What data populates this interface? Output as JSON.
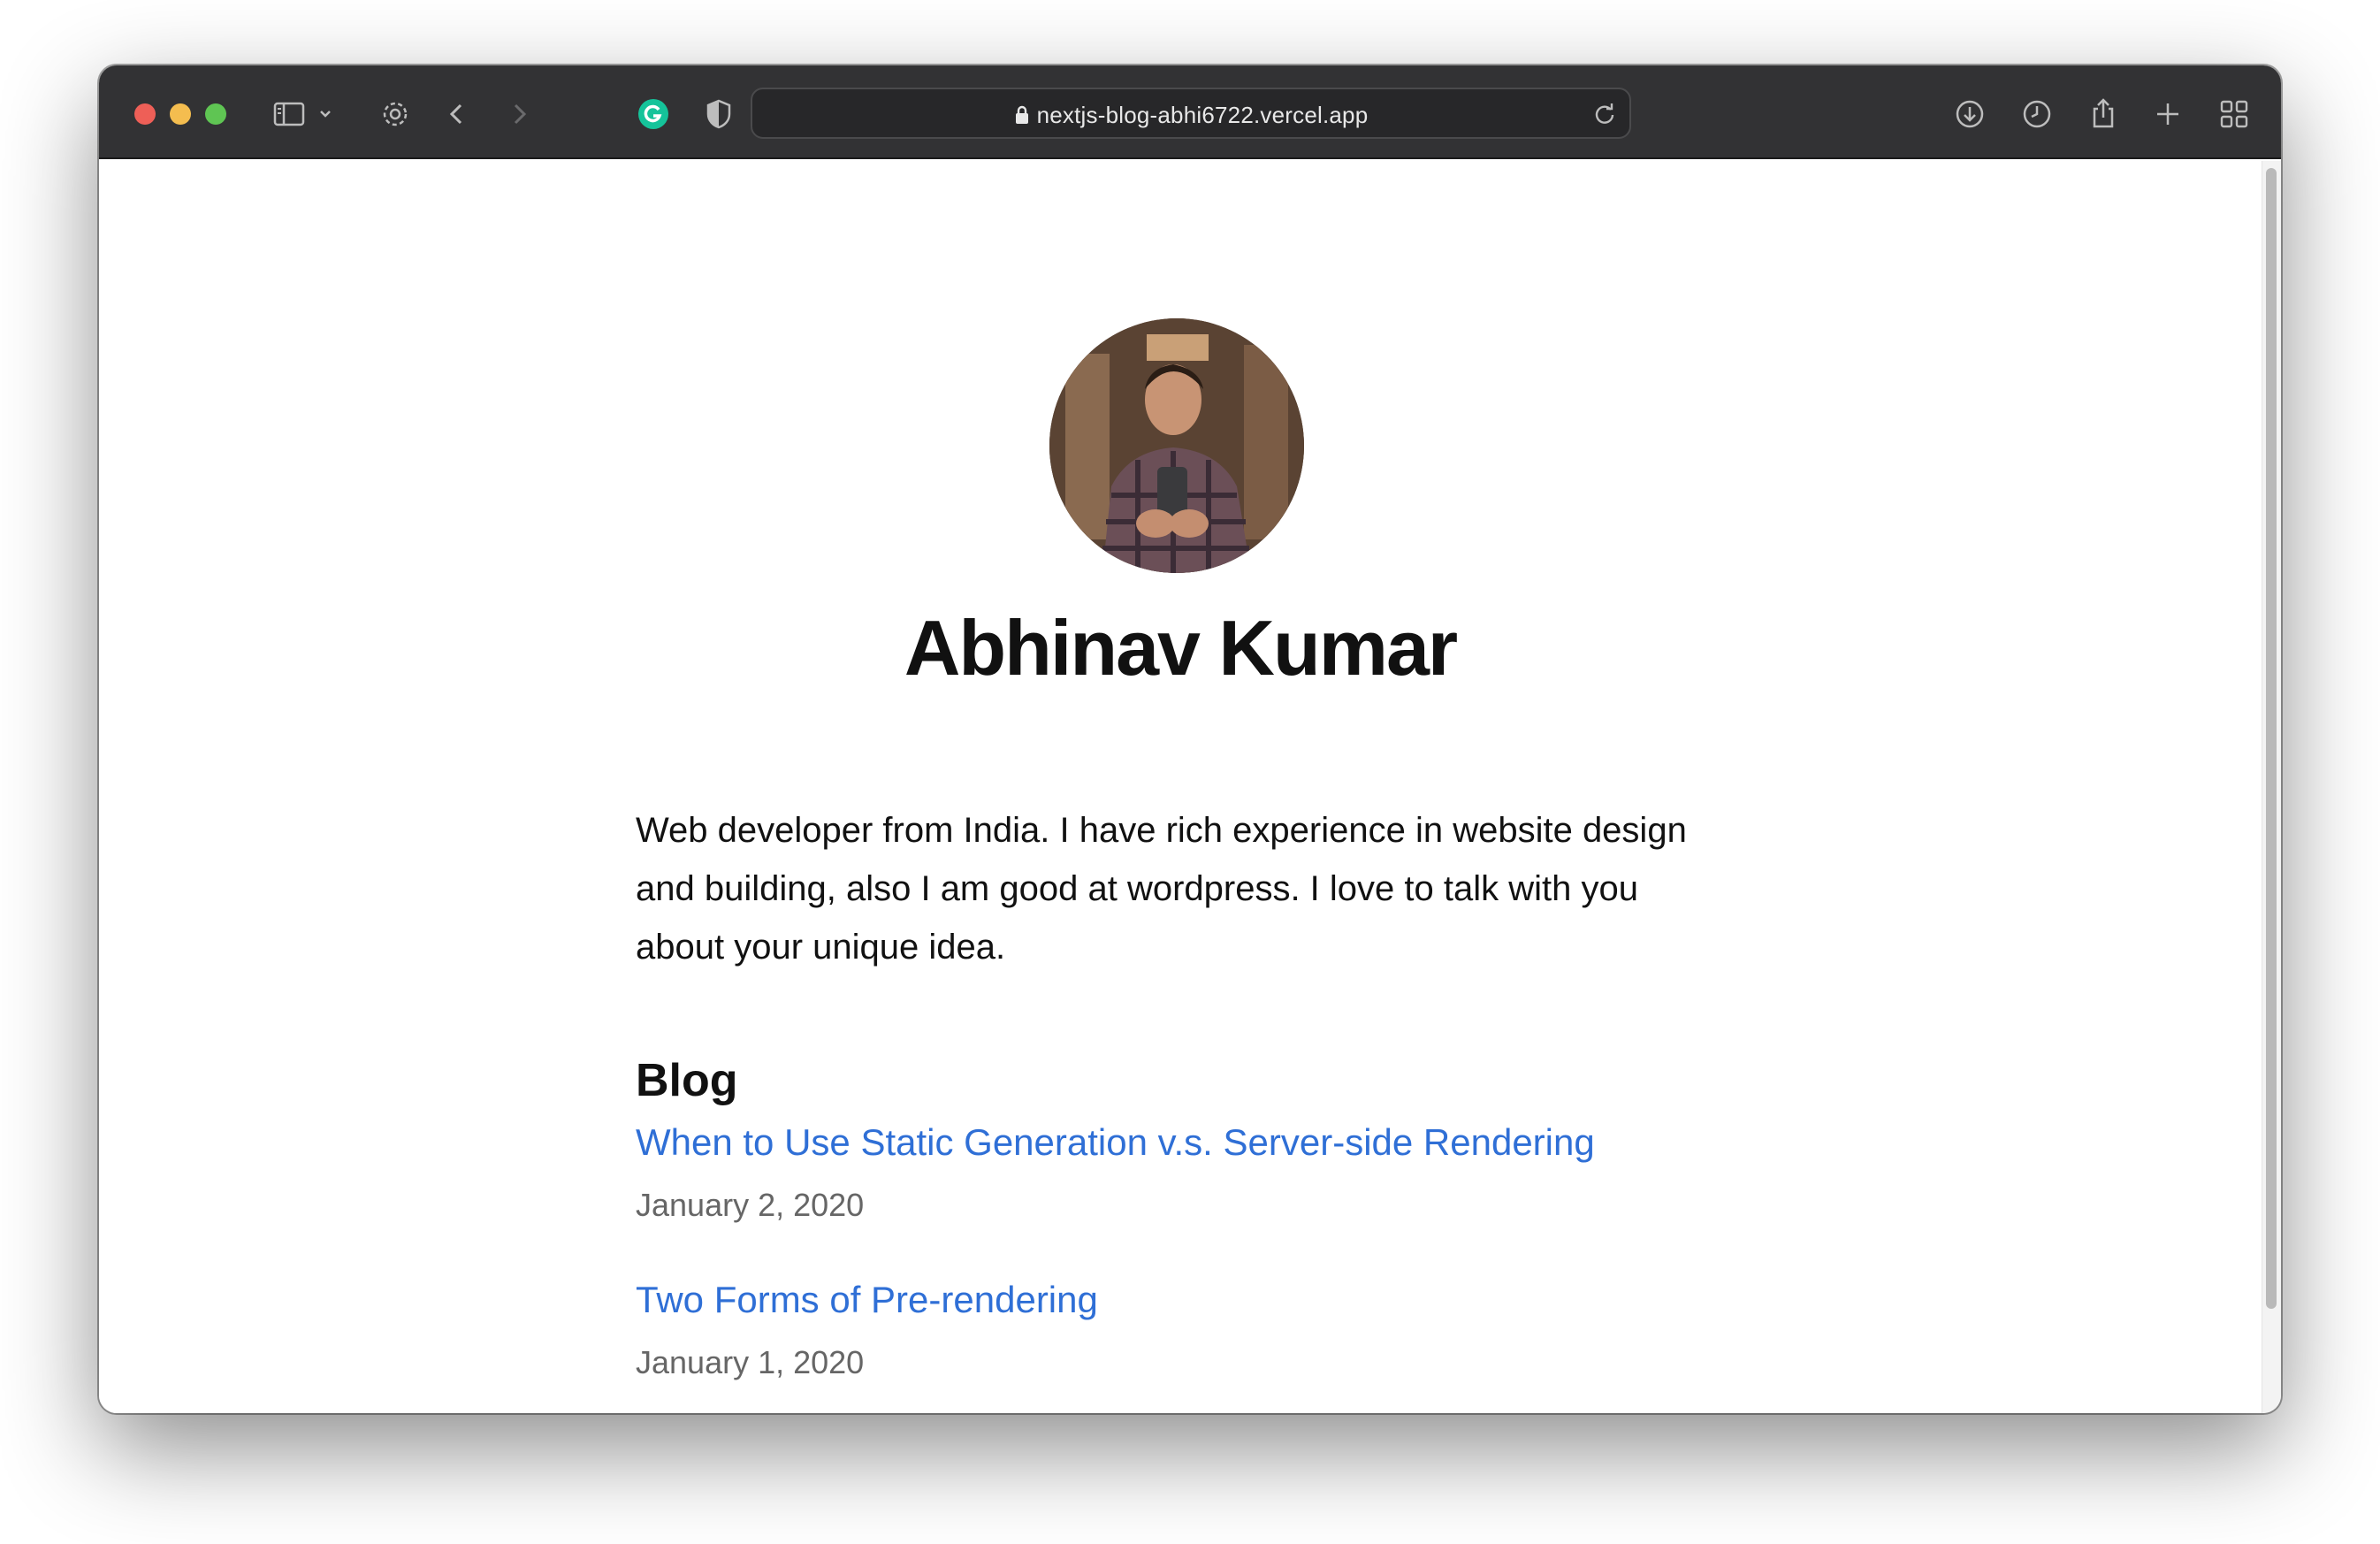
{
  "browser": {
    "url": "nextjs-blog-abhi6722.vercel.app",
    "icons": {
      "sidebar": "sidebar-icon",
      "tab_menu": "chevron-down-icon",
      "settings": "gear-icon",
      "back": "chevron-left-icon",
      "forward": "chevron-right-icon",
      "grammarly": "grammarly-icon",
      "privacy": "shield-icon",
      "lock": "lock-icon",
      "reload": "reload-icon",
      "downloads": "download-icon",
      "history": "clock-icon",
      "share": "share-icon",
      "new_tab": "plus-icon",
      "tab_overview": "grid-icon"
    }
  },
  "profile": {
    "name": "Abhinav Kumar",
    "bio": "Web developer from India. I have rich experience in website design and building, also I am good at wordpress. I love to talk with you about your unique idea."
  },
  "blog": {
    "heading": "Blog",
    "posts": [
      {
        "title": "When to Use Static Generation v.s. Server-side Rendering",
        "date": "January 2, 2020"
      },
      {
        "title": "Two Forms of Pre-rendering",
        "date": "January 1, 2020"
      }
    ]
  },
  "colors": {
    "toolbar": "#323234",
    "link": "#2f6fd6",
    "date": "#666666",
    "close": "#ee5f57",
    "minimize": "#f4bd4f",
    "maximize": "#5fc553",
    "grammarly": "#15c39a"
  }
}
